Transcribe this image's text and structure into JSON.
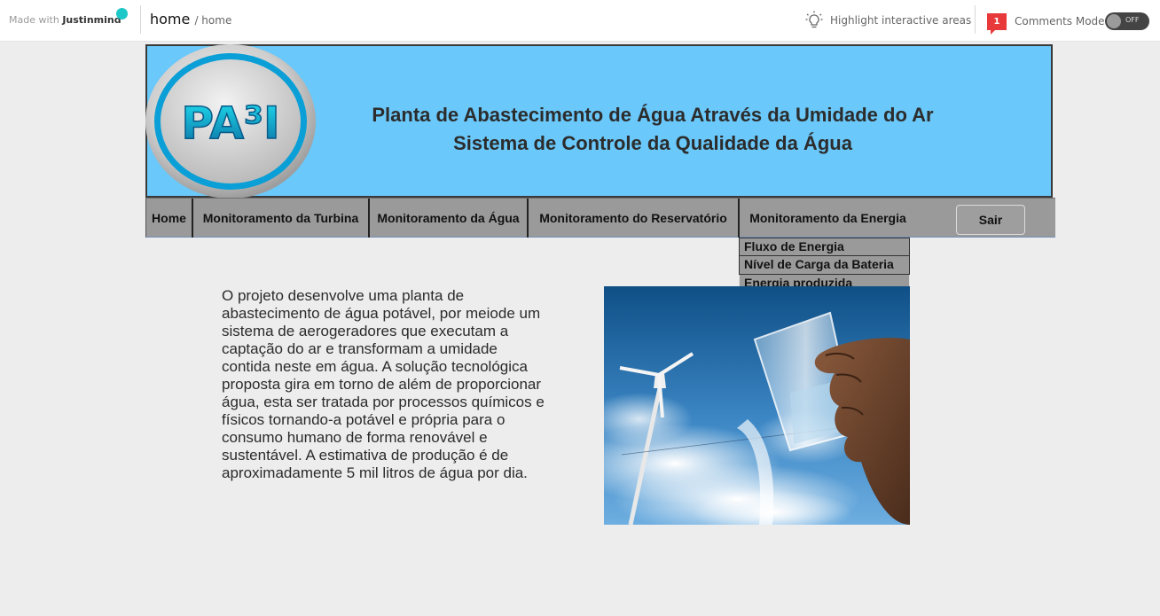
{
  "topbar": {
    "made_with_prefix": "Made with",
    "made_with_brand": "Justinmind",
    "breadcrumb_main": "home",
    "breadcrumb_sub": "/ home",
    "highlight_label": "Highlight interactive areas",
    "comments_count": "1",
    "comments_label": "Comments Mode",
    "toggle_label": "OFF"
  },
  "header": {
    "logo_text": "PA³I",
    "title_line1": "Planta de Abastecimento de Água Através da Umidade do Ar",
    "title_line2": "Sistema de Controle da Qualidade da Água"
  },
  "nav": {
    "items": [
      {
        "label": "Home"
      },
      {
        "label": "Monitoramento da Turbina"
      },
      {
        "label": "Monitoramento da Água"
      },
      {
        "label": "Monitoramento do Reservatório"
      },
      {
        "label": "Monitoramento da Energia"
      }
    ],
    "sair_label": "Sair"
  },
  "dropdown": {
    "items": [
      {
        "label": "Fluxo de Energia"
      },
      {
        "label": "Nível de Carga da Bateria"
      },
      {
        "label": "Energia produzida"
      }
    ]
  },
  "content": {
    "paragraph": "     O projeto desenvolve uma planta de\nabastecimento de água potável, por meiode um\nsistema de aerogeradores que executam a\n captação do ar e transformam a umidade\ncontida neste em água. A solução tecnológica\n proposta gira em torno de além de proporcionar\nágua, esta ser tratada por processos químicos e\nfísicos tornando-a potável e própria para o\nconsumo humano de forma renovável e\nsustentável. A estimativa de produção é de\naproximadamente 5 mil litros de água por dia."
  },
  "colors": {
    "banner": "#6ac8fa",
    "nav": "#9a9a9a",
    "background": "#ededed"
  }
}
